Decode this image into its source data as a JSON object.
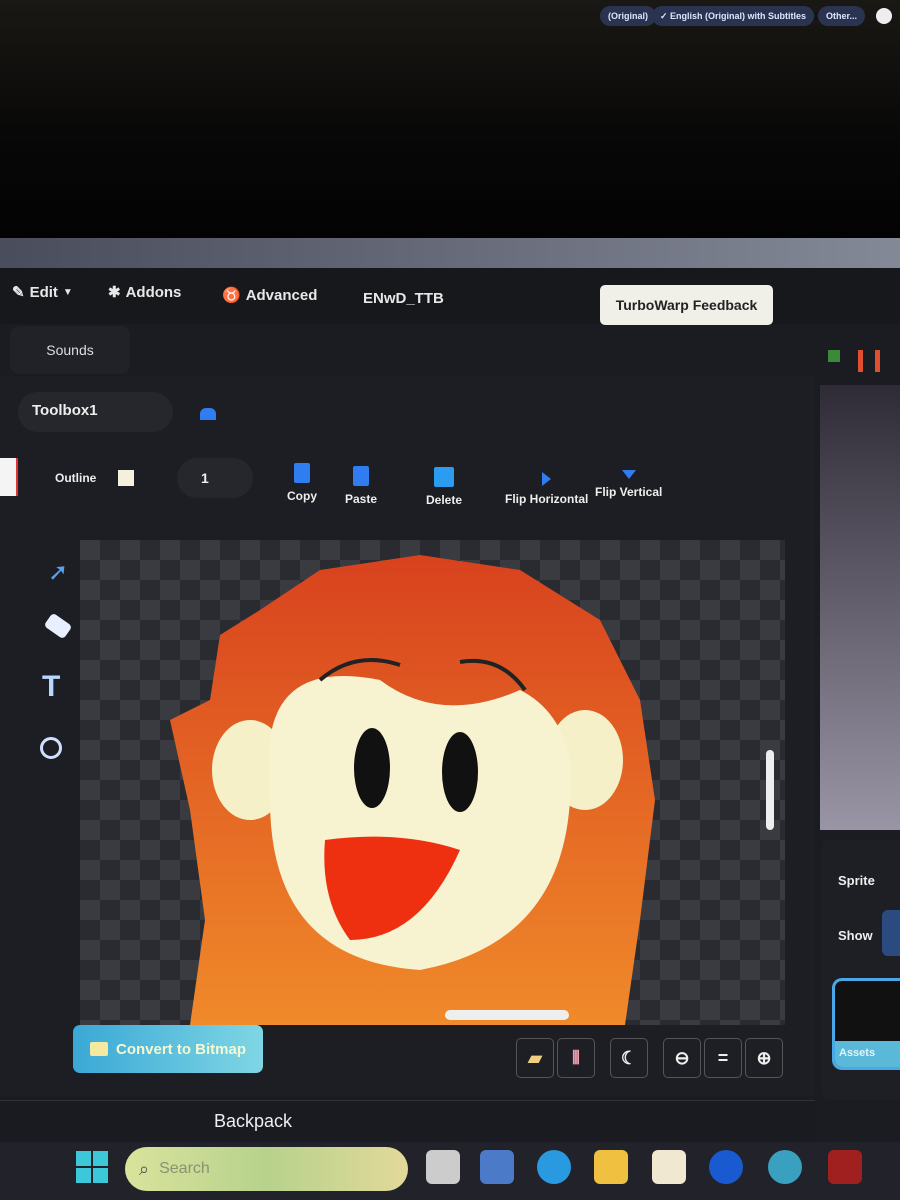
{
  "video_bar": {
    "pills": [
      "(Original)",
      "✓ English (Original) with Subtitles",
      "Other..."
    ]
  },
  "menu": {
    "edit": "Edit",
    "addons": "Addons",
    "advanced": "Advanced",
    "project_title": "ENwD_TTB",
    "feedback": "TurboWarp Feedback"
  },
  "tabs": {
    "sounds": "Sounds"
  },
  "paint": {
    "costume_name": "Toolbox1",
    "outline_label": "Outline",
    "outline_width": "1",
    "actions": [
      {
        "label": "Copy",
        "icon": "copy-icon"
      },
      {
        "label": "Paste",
        "icon": "paste-icon"
      },
      {
        "label": "Delete",
        "icon": "trash-icon"
      },
      {
        "label": "Flip Horizontal",
        "icon": "flip-horizontal-icon"
      },
      {
        "label": "Flip Vertical",
        "icon": "flip-vertical-icon"
      }
    ],
    "tools": [
      "select-icon",
      "eraser-icon",
      "text-icon",
      "circle-icon"
    ],
    "convert": "Convert to Bitmap",
    "zoom_reset": "="
  },
  "sprite_panel": {
    "sprite_label": "Sprite",
    "show_label": "Show",
    "assets_label": "Assets"
  },
  "backpack": "Backpack",
  "taskbar": {
    "search_placeholder": "Search"
  },
  "colors": {
    "accent": "#2f7df0",
    "feedback_bg": "#f1f0e8",
    "hair": "#e0501e",
    "convert_btn": "#3aa8d6"
  }
}
